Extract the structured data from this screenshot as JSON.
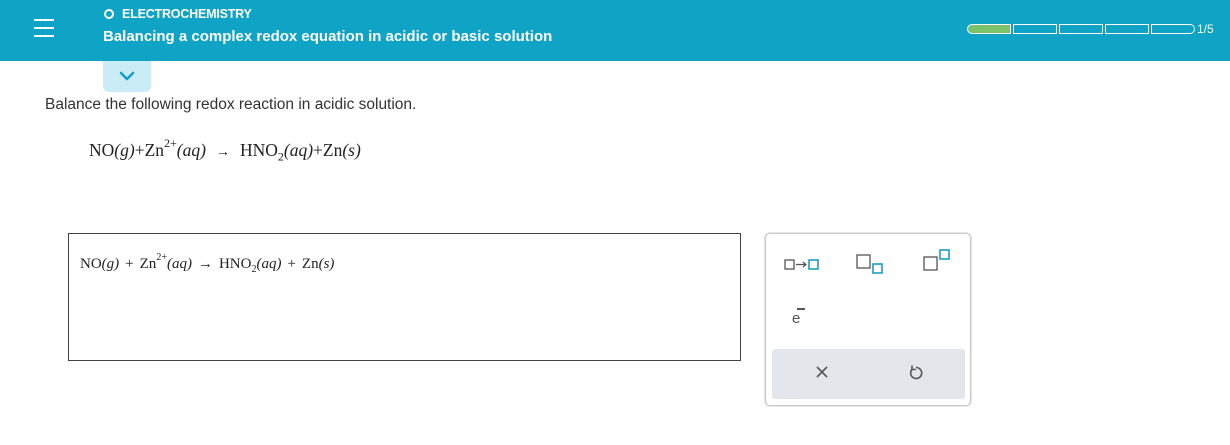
{
  "header": {
    "topic": "ELECTROCHEMISTRY",
    "title": "Balancing a complex redox equation in acidic or basic solution",
    "progress_label": "1/5",
    "progress_completed": 1,
    "progress_total": 5,
    "accent_color": "#0fa3c6",
    "progress_color": "#7bc36b"
  },
  "question": {
    "prompt": "Balance the following redox reaction in acidic solution.",
    "reactant1": "NO",
    "reactant1_state": "(g)",
    "plus": "+",
    "reactant2": "Zn",
    "reactant2_charge": "2+",
    "reactant2_state": "(aq)",
    "arrow": "→",
    "product1_a": "HNO",
    "product1_sub": "2",
    "product1_state": "(aq)",
    "product2": "Zn",
    "product2_state": "(s)"
  },
  "answer": {
    "reactant1": "NO",
    "reactant1_state": "(g)",
    "plus": "+",
    "reactant2": "Zn",
    "reactant2_charge": "2+",
    "reactant2_state": "(aq)",
    "arrow": "→",
    "product1_a": "HNO",
    "product1_sub": "2",
    "product1_state": "(aq)",
    "product2": "Zn",
    "product2_state": "(s)"
  },
  "toolbox": {
    "tools": [
      "reaction-arrow-icon",
      "subscript-icon",
      "superscript-icon",
      "electron-icon"
    ],
    "electron_label": "e",
    "clear_icon": "close-icon",
    "reset_icon": "undo-icon"
  }
}
